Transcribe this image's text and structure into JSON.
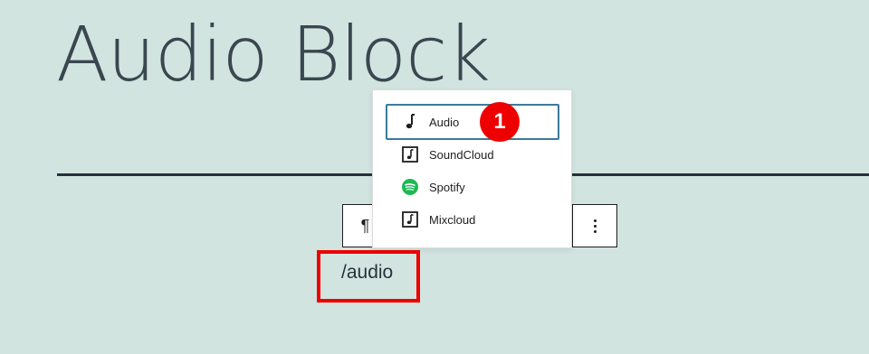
{
  "page": {
    "title": "Audio Block"
  },
  "block_toolbar": {
    "paragraph_icon": "pilcrow-icon",
    "options_icon": "more-vertical-icon",
    "paragraph_glyph": "¶"
  },
  "editor": {
    "command_text": "/audio"
  },
  "inserter": {
    "items": [
      {
        "label": "Audio",
        "icon": "audio-note-icon",
        "selected": true
      },
      {
        "label": "SoundCloud",
        "icon": "embed-audio-icon",
        "selected": false
      },
      {
        "label": "Spotify",
        "icon": "spotify-icon",
        "selected": false
      },
      {
        "label": "Mixcloud",
        "icon": "embed-audio-icon",
        "selected": false
      }
    ]
  },
  "annotations": {
    "step_badge": "1",
    "highlight_color": "#ee0000",
    "badge_color": "#ee0000"
  },
  "colors": {
    "background": "#d2e4df",
    "text": "#28303d",
    "selected_outline": "#3b7a9c",
    "spotify_green": "#1db954"
  }
}
